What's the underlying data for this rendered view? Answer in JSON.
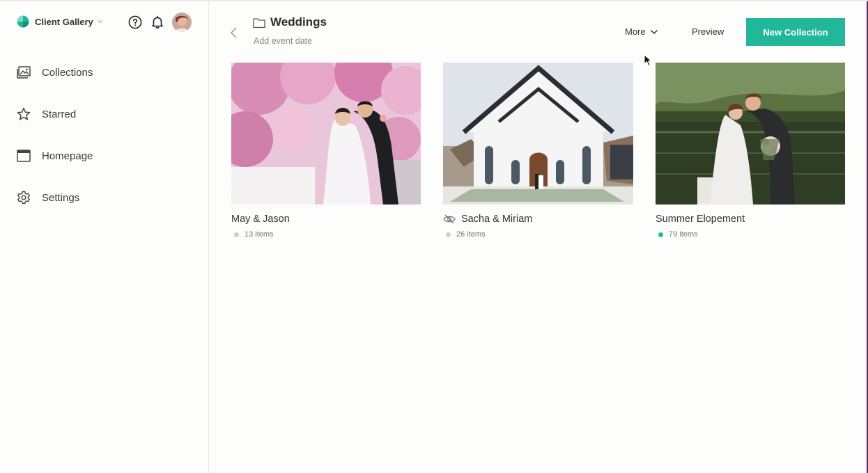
{
  "brand": {
    "name": "Client Gallery",
    "logo_color": "#21b899"
  },
  "topbar": {
    "help_icon": "help-circle-icon",
    "bell_icon": "bell-icon",
    "avatar": "user-avatar"
  },
  "sidebar": {
    "items": [
      {
        "label": "Collections",
        "icon": "image-icon"
      },
      {
        "label": "Starred",
        "icon": "star-icon"
      },
      {
        "label": "Homepage",
        "icon": "browser-window-icon"
      },
      {
        "label": "Settings",
        "icon": "gear-icon"
      }
    ]
  },
  "header": {
    "title": "Weddings",
    "add_date": "Add event date",
    "more_label": "More",
    "preview_label": "Preview",
    "new_collection_label": "New Collection",
    "accent": "#21b899"
  },
  "collections": [
    {
      "title": "May & Jason",
      "count": "13 items",
      "status": "draft",
      "hidden": false
    },
    {
      "title": "Sacha & Miriam",
      "count": "26 items",
      "status": "draft",
      "hidden": true
    },
    {
      "title": "Summer Elopement",
      "count": "79 items",
      "status": "published",
      "hidden": false
    }
  ]
}
